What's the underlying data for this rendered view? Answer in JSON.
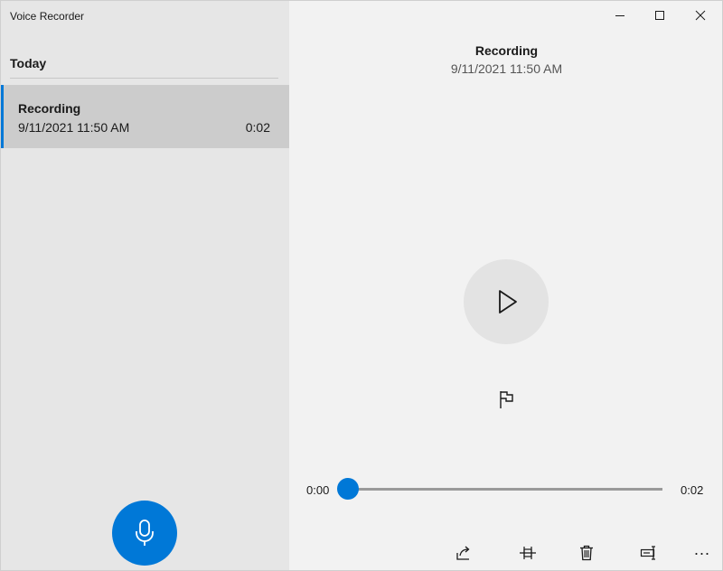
{
  "app": {
    "title": "Voice Recorder",
    "accent_color": "#0078d7"
  },
  "sidebar": {
    "group_header": "Today",
    "recordings": [
      {
        "name": "Recording",
        "date": "9/11/2021 11:50 AM",
        "duration": "0:02",
        "selected": true
      }
    ],
    "record_button_icon": "microphone-icon"
  },
  "window_controls": {
    "minimize_icon": "minimize-icon",
    "maximize_icon": "maximize-icon",
    "close_icon": "close-icon"
  },
  "player": {
    "title": "Recording",
    "date": "9/11/2021 11:50 AM",
    "current_time": "0:00",
    "total_time": "0:02",
    "progress": 0,
    "play_icon": "play-icon",
    "marker_icon": "flag-icon"
  },
  "toolbar": {
    "items": [
      {
        "name": "share",
        "icon": "share-icon"
      },
      {
        "name": "trim",
        "icon": "trim-icon"
      },
      {
        "name": "delete",
        "icon": "delete-icon"
      },
      {
        "name": "rename",
        "icon": "rename-icon"
      }
    ],
    "more_label": "..."
  }
}
